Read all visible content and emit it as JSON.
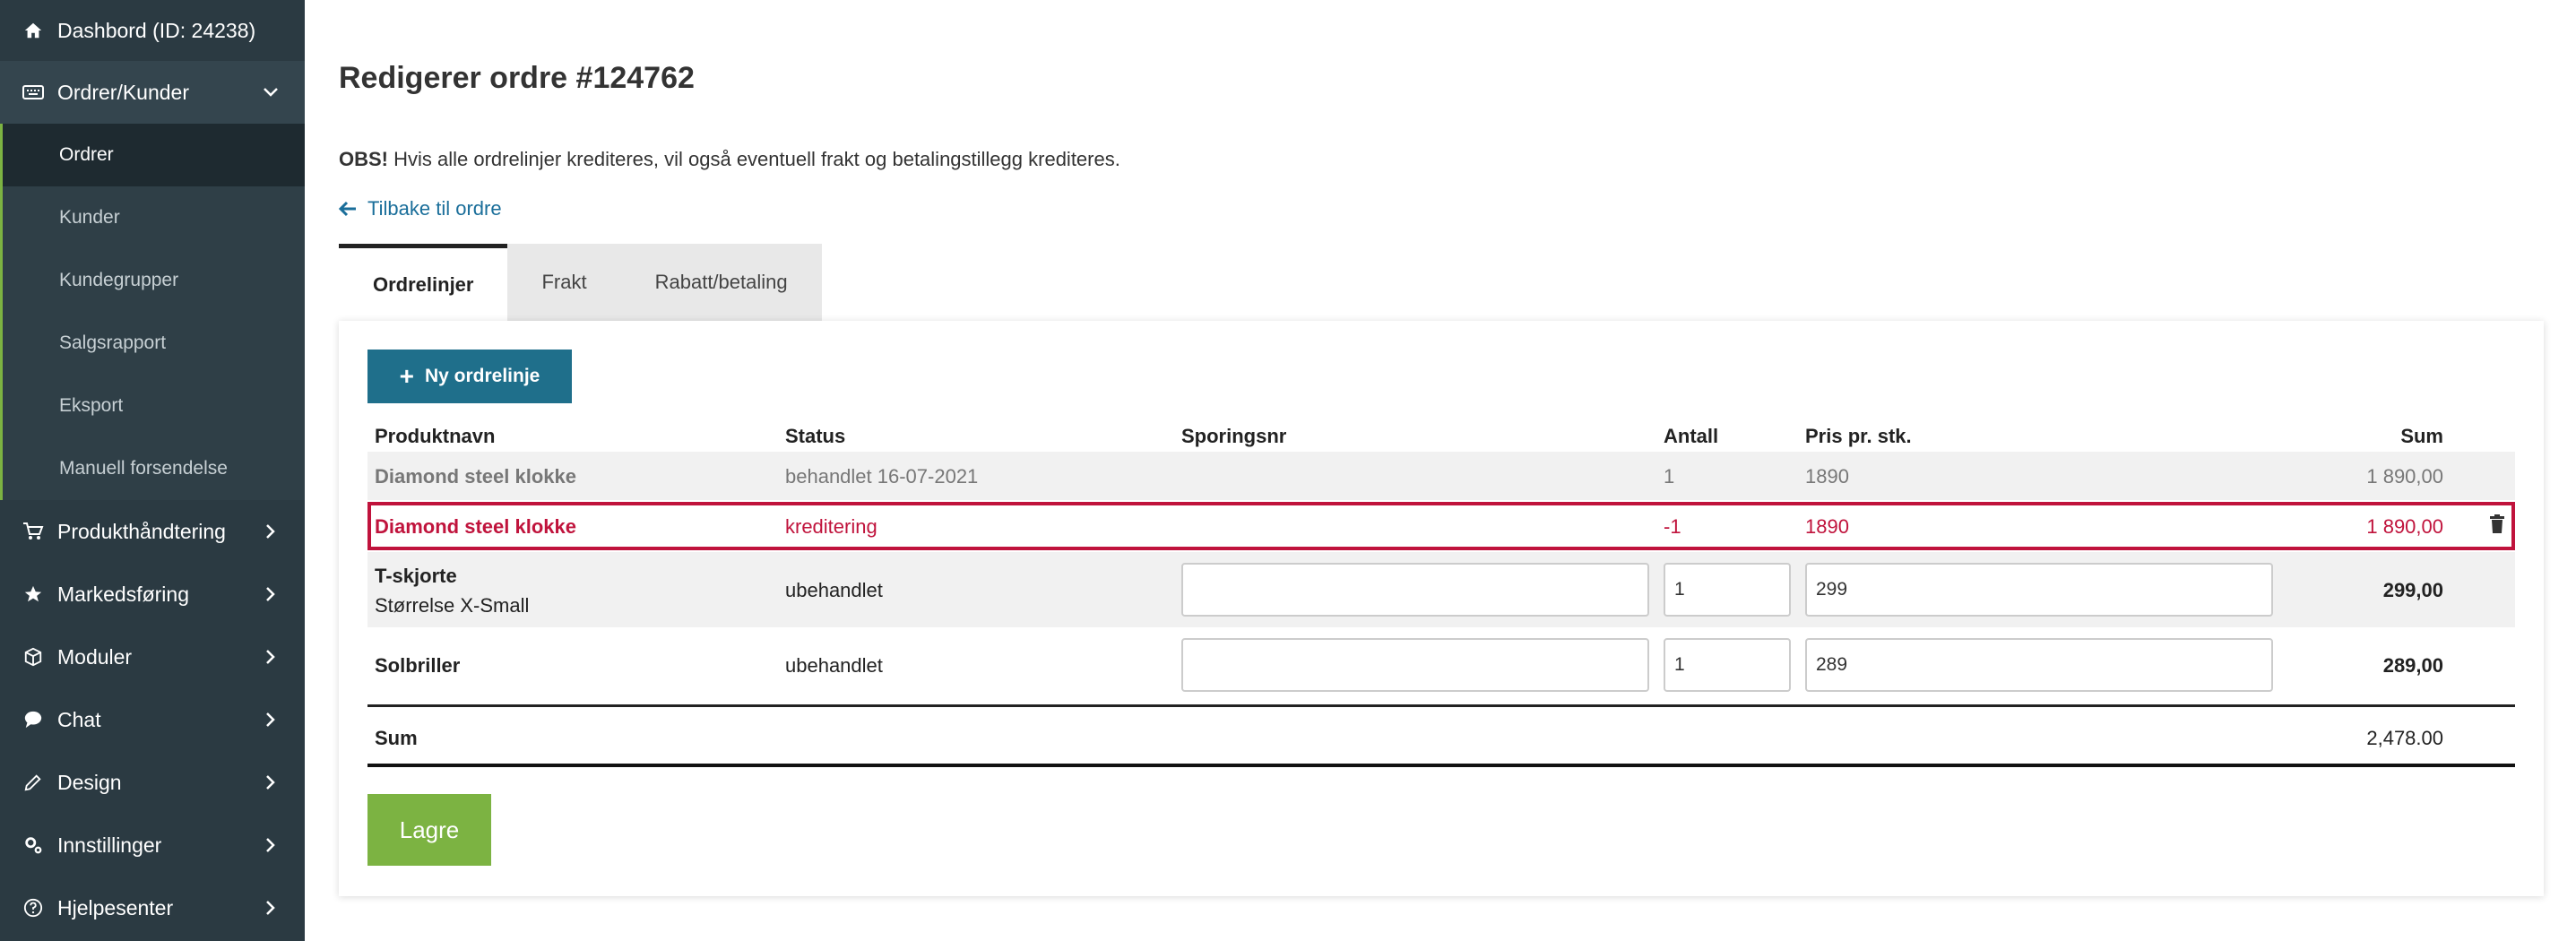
{
  "sidebar": {
    "dashboard": "Dashbord (ID: 24238)",
    "orders_customers": "Ordrer/Kunder",
    "sub_items": [
      "Ordrer",
      "Kunder",
      "Kundegrupper",
      "Salgsrapport",
      "Eksport",
      "Manuell forsendelse"
    ],
    "product_management": "Produkthåndtering",
    "marketing": "Markedsføring",
    "modules": "Moduler",
    "chat": "Chat",
    "design": "Design",
    "settings": "Innstillinger",
    "help_center": "Hjelpesenter"
  },
  "page": {
    "title": "Redigerer ordre #124762",
    "notice_bold": "OBS!",
    "notice_text": " Hvis alle ordrelinjer krediteres, vil også eventuell frakt og betalingstillegg krediteres.",
    "back_link": "Tilbake til ordre"
  },
  "tabs": [
    "Ordrelinjer",
    "Frakt",
    "Rabatt/betaling"
  ],
  "toolbar": {
    "new_line": "Ny ordrelinje"
  },
  "table": {
    "headers": {
      "product": "Produktnavn",
      "status": "Status",
      "tracking": "Sporingsnr",
      "qty": "Antall",
      "price": "Pris pr. stk.",
      "sum": "Sum"
    },
    "rows": [
      {
        "product": "Diamond steel klokke",
        "status": "behandlet 16-07-2021",
        "qty": "1",
        "price": "1890",
        "sum": "1 890,00"
      },
      {
        "product": "Diamond steel klokke",
        "status": "kreditering",
        "qty": "-1",
        "price": "1890",
        "sum": "1 890,00"
      },
      {
        "product": "T-skjorte",
        "variant": "Størrelse X-Small",
        "status": "ubehandlet",
        "tracking": "",
        "qty": "1",
        "price": "299",
        "sum": "299,00"
      },
      {
        "product": "Solbriller",
        "status": "ubehandlet",
        "tracking": "",
        "qty": "1",
        "price": "289",
        "sum": "289,00"
      }
    ],
    "total_label": "Sum",
    "total_value": "2,478.00"
  },
  "save_label": "Lagre",
  "colors": {
    "sidebar": "#2b3a42",
    "accent_green": "#7cb342",
    "primary_blue": "#1f6f8b",
    "credit_red": "#c0133c",
    "link_blue": "#1a6e9a"
  }
}
